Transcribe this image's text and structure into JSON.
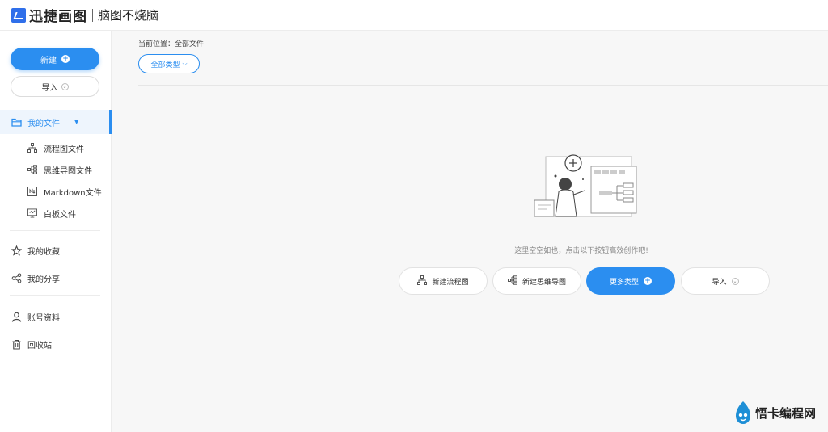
{
  "header": {
    "logo_text": "迅捷画图",
    "slogan": "脑图不烧脑"
  },
  "sidebar": {
    "new_button": "新建",
    "import_button": "导入",
    "my_files": "我的文件",
    "sub_items": [
      {
        "label": "流程图文件",
        "icon": "flowchart-icon"
      },
      {
        "label": "思维导图文件",
        "icon": "mindmap-icon"
      },
      {
        "label": "Markdown文件",
        "icon": "markdown-icon"
      },
      {
        "label": "白板文件",
        "icon": "whiteboard-icon"
      }
    ],
    "favorites": "我的收藏",
    "shares": "我的分享",
    "account": "账号资料",
    "recycle": "回收站"
  },
  "main": {
    "breadcrumb": "当前位置：全部文件",
    "type_filter": "全部类型",
    "empty_text": "这里空空如也，点击以下按钮高效创作吧!",
    "actions": {
      "new_flowchart": "新建流程图",
      "new_mindmap": "新建思维导图",
      "more_types": "更多类型",
      "import": "导入"
    }
  },
  "watermark": {
    "text": "悟卡编程网"
  },
  "colors": {
    "accent": "#2b8ef0",
    "brand": "#2f6fea"
  }
}
